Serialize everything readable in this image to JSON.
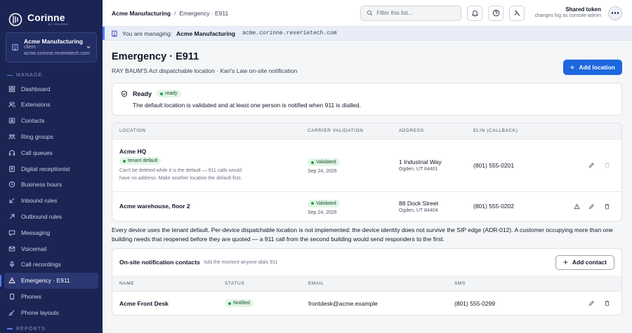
{
  "brand": {
    "name": "Corinne",
    "by": "BY REVERIE"
  },
  "tenant": {
    "name": "Acme Manufacturing",
    "type": "client ·",
    "host": "acme.corinne.reverietech.com"
  },
  "nav": {
    "manage_label": "MANAGE",
    "reports_label": "REPORTS",
    "items": [
      {
        "label": "Dashboard",
        "icon": "grid-icon"
      },
      {
        "label": "Extensions",
        "icon": "users-icon"
      },
      {
        "label": "Contacts",
        "icon": "contact-card-icon"
      },
      {
        "label": "Ring groups",
        "icon": "ring-group-icon"
      },
      {
        "label": "Call queues",
        "icon": "headset-icon"
      },
      {
        "label": "Digital receptionist",
        "icon": "receptionist-icon"
      },
      {
        "label": "Business hours",
        "icon": "clock-icon"
      },
      {
        "label": "Inbound rules",
        "icon": "arrow-down-left-icon"
      },
      {
        "label": "Outbound rules",
        "icon": "arrow-up-right-icon"
      },
      {
        "label": "Messaging",
        "icon": "message-icon"
      },
      {
        "label": "Voicemail",
        "icon": "voicemail-icon"
      },
      {
        "label": "Call recordings",
        "icon": "microphone-icon"
      },
      {
        "label": "Emergency · E911",
        "icon": "alert-triangle-icon",
        "active": true
      },
      {
        "label": "Phones",
        "icon": "phone-icon"
      },
      {
        "label": "Phone layouts",
        "icon": "brush-icon"
      }
    ]
  },
  "topbar": {
    "crumb_parent": "Acme Manufacturing",
    "crumb_sep": "/",
    "crumb_current": "Emergency · E911",
    "filter_placeholder": "Filter this list...",
    "token_title": "Shared token",
    "token_sub": "changes log as console-admin"
  },
  "managing": {
    "prefix": "You are managing:",
    "name": "Acme Manufacturing",
    "host": "acme.corinne.reverietech.com"
  },
  "page": {
    "title": "Emergency · E911",
    "subtitle": "RAY BAUM'S Act dispatchable location · Kari's Law on-site notification",
    "add_location_label": "Add location"
  },
  "ready": {
    "title": "Ready",
    "badge": "ready",
    "description": "The default location is validated and at least one person is notified when 911 is dialled."
  },
  "locations": {
    "columns": [
      "LOCATION",
      "CARRIER VALIDATION",
      "ADDRESS",
      "ELIN (CALLBACK)"
    ],
    "rows": [
      {
        "name": "Acme HQ",
        "tag": "tenant default",
        "note": "Can't be deleted while it is the default — 911 calls would have no address. Make another location the default first.",
        "validation": "Validated",
        "validated_on": "Sep 24, 2026",
        "address1": "1 Industrial Way",
        "address2": "Ogden, UT 84401",
        "elin": "(801) 555-0201"
      },
      {
        "name": "Acme warehouse, floor 2",
        "validation": "Validated",
        "validated_on": "Sep 24, 2026",
        "address1": "88 Dock Street",
        "address2": "Ogden, UT 84404",
        "elin": "(801) 555-0202"
      }
    ]
  },
  "notice": "Every device uses the tenant default. Per-device dispatchable location is not implemented: the device identity does not survive the SIP edge (ADR-012). A customer occupying more than one building needs that reopened before they are quoted — a 911 call from the second building would send responders to the first.",
  "contacts": {
    "title": "On-site notification contacts",
    "subtitle": "told the moment anyone dials 911",
    "add_label": "Add contact",
    "columns": [
      "NAME",
      "STATUS",
      "EMAIL",
      "SMS"
    ],
    "rows": [
      {
        "name": "Acme Front Desk",
        "status": "Notified",
        "email": "frontdesk@acme.example",
        "sms": "(801) 555-0299"
      }
    ]
  }
}
